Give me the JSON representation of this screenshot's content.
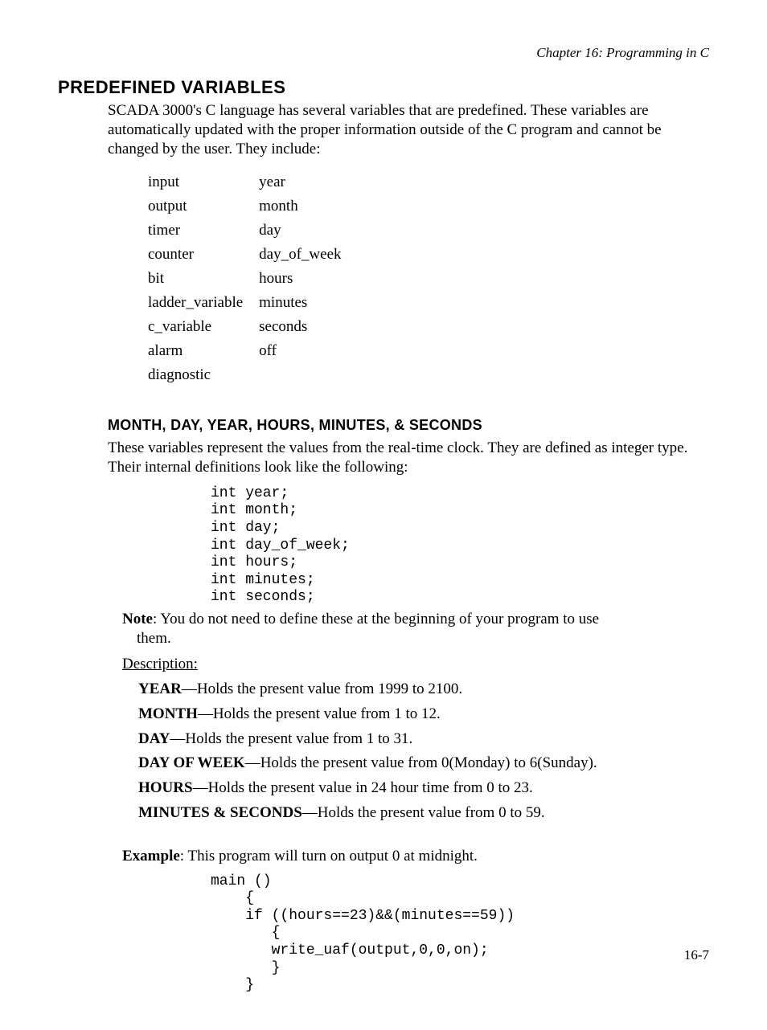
{
  "running_head": "Chapter 16: Programming in C",
  "h1": "PREDEFINED VARIABLES",
  "intro": "SCADA 3000's C language has several variables that are predefined.  These variables are automatically updated with the proper information outside of the C program and cannot be changed by the user.  They include:",
  "vars": {
    "col1": [
      "input",
      "output",
      "timer",
      "counter",
      "bit",
      "ladder_variable",
      "c_variable",
      "alarm",
      "diagnostic"
    ],
    "col2": [
      "year",
      "month",
      "day",
      "day_of_week",
      "hours",
      "minutes",
      "seconds",
      "off",
      ""
    ]
  },
  "h2": "MONTH, DAY, YEAR, HOURS, MINUTES, & SECONDS",
  "para1": "These variables represent the values from the real-time clock.  They are defined as integer type.   Their internal definitions look like the following:",
  "code1": "int year;\nint month;\nint day;\nint day_of_week;\nint hours;\nint minutes;\nint seconds;",
  "note_bold": "Note",
  "note_text_line1": ":  You do not need to define these at the beginning of your program to use",
  "note_text_line2": "them.",
  "desc_head": "Description:",
  "descs": [
    {
      "term": "YEAR",
      "text": "—Holds the present value from 1999 to 2100."
    },
    {
      "term": "MONTH",
      "text": "—Holds the present value from 1 to 12."
    },
    {
      "term": "DAY",
      "text": "—Holds the present value from 1 to 31."
    },
    {
      "term": "DAY OF WEEK",
      "text": "—Holds the present value from 0(Monday) to 6(Sunday)."
    },
    {
      "term": "HOURS",
      "text": "—Holds the present value in  24 hour time from 0 to 23."
    },
    {
      "term": "MINUTES & SECONDS",
      "text": "—Holds the present value from 0 to 59."
    }
  ],
  "example_bold": "Example",
  "example_text": ": This program will turn on output 0 at midnight.",
  "code2": "main ()\n    {\n    if ((hours==23)&&(minutes==59))\n       {\n       write_uaf(output,0,0,on);\n       }\n    }",
  "page_num": "16-7"
}
